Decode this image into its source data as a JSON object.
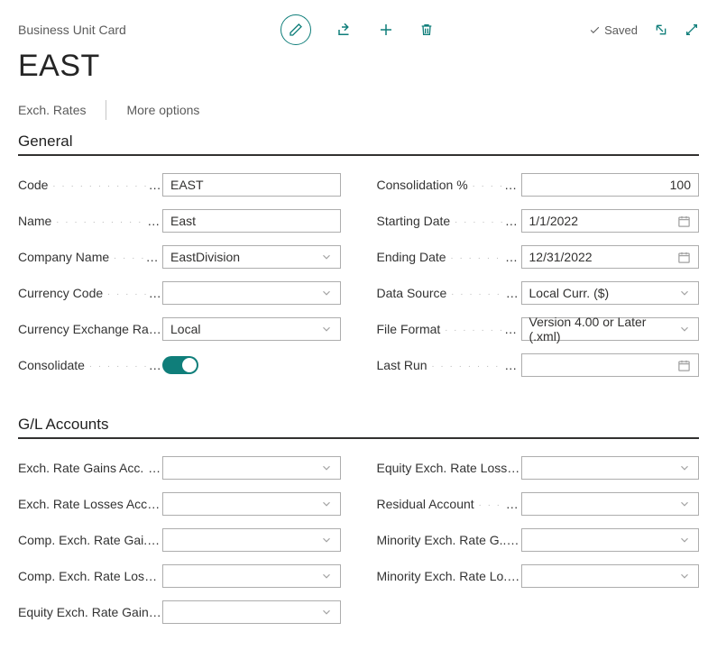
{
  "header": {
    "card_label": "Business Unit Card",
    "saved_label": "Saved"
  },
  "page_title": "EAST",
  "action_bar": {
    "exch_rates": "Exch. Rates",
    "more_options": "More options"
  },
  "sections": {
    "general": "General",
    "gl_accounts": "G/L Accounts"
  },
  "general": {
    "code": {
      "label": "Code",
      "value": "EAST"
    },
    "name": {
      "label": "Name",
      "value": "East"
    },
    "company_name": {
      "label": "Company Name",
      "value": "EastDivision"
    },
    "currency_code": {
      "label": "Currency Code",
      "value": ""
    },
    "currency_exch_rate": {
      "label": "Currency Exchange Ra...",
      "value": "Local"
    },
    "consolidate": {
      "label": "Consolidate"
    },
    "consolidation_pct": {
      "label": "Consolidation %",
      "value": "100"
    },
    "starting_date": {
      "label": "Starting Date",
      "value": "1/1/2022"
    },
    "ending_date": {
      "label": "Ending Date",
      "value": "12/31/2022"
    },
    "data_source": {
      "label": "Data Source",
      "value": "Local Curr. ($)"
    },
    "file_format": {
      "label": "File Format",
      "value": "Version 4.00 or Later (.xml)"
    },
    "last_run": {
      "label": "Last Run",
      "value": ""
    }
  },
  "gl": {
    "exch_gains": {
      "label": "Exch. Rate Gains Acc.",
      "value": ""
    },
    "exch_losses": {
      "label": "Exch. Rate Losses Acc.",
      "value": ""
    },
    "comp_gains": {
      "label": "Comp. Exch. Rate Gai...",
      "value": ""
    },
    "comp_losses": {
      "label": "Comp. Exch. Rate Loss...",
      "value": ""
    },
    "equity_gains": {
      "label": "Equity Exch. Rate Gain...",
      "value": ""
    },
    "equity_losses": {
      "label": "Equity Exch. Rate Loss...",
      "value": ""
    },
    "residual": {
      "label": "Residual Account",
      "value": ""
    },
    "min_gains": {
      "label": "Minority Exch. Rate G...",
      "value": ""
    },
    "min_losses": {
      "label": "Minority Exch. Rate Lo...",
      "value": ""
    }
  }
}
